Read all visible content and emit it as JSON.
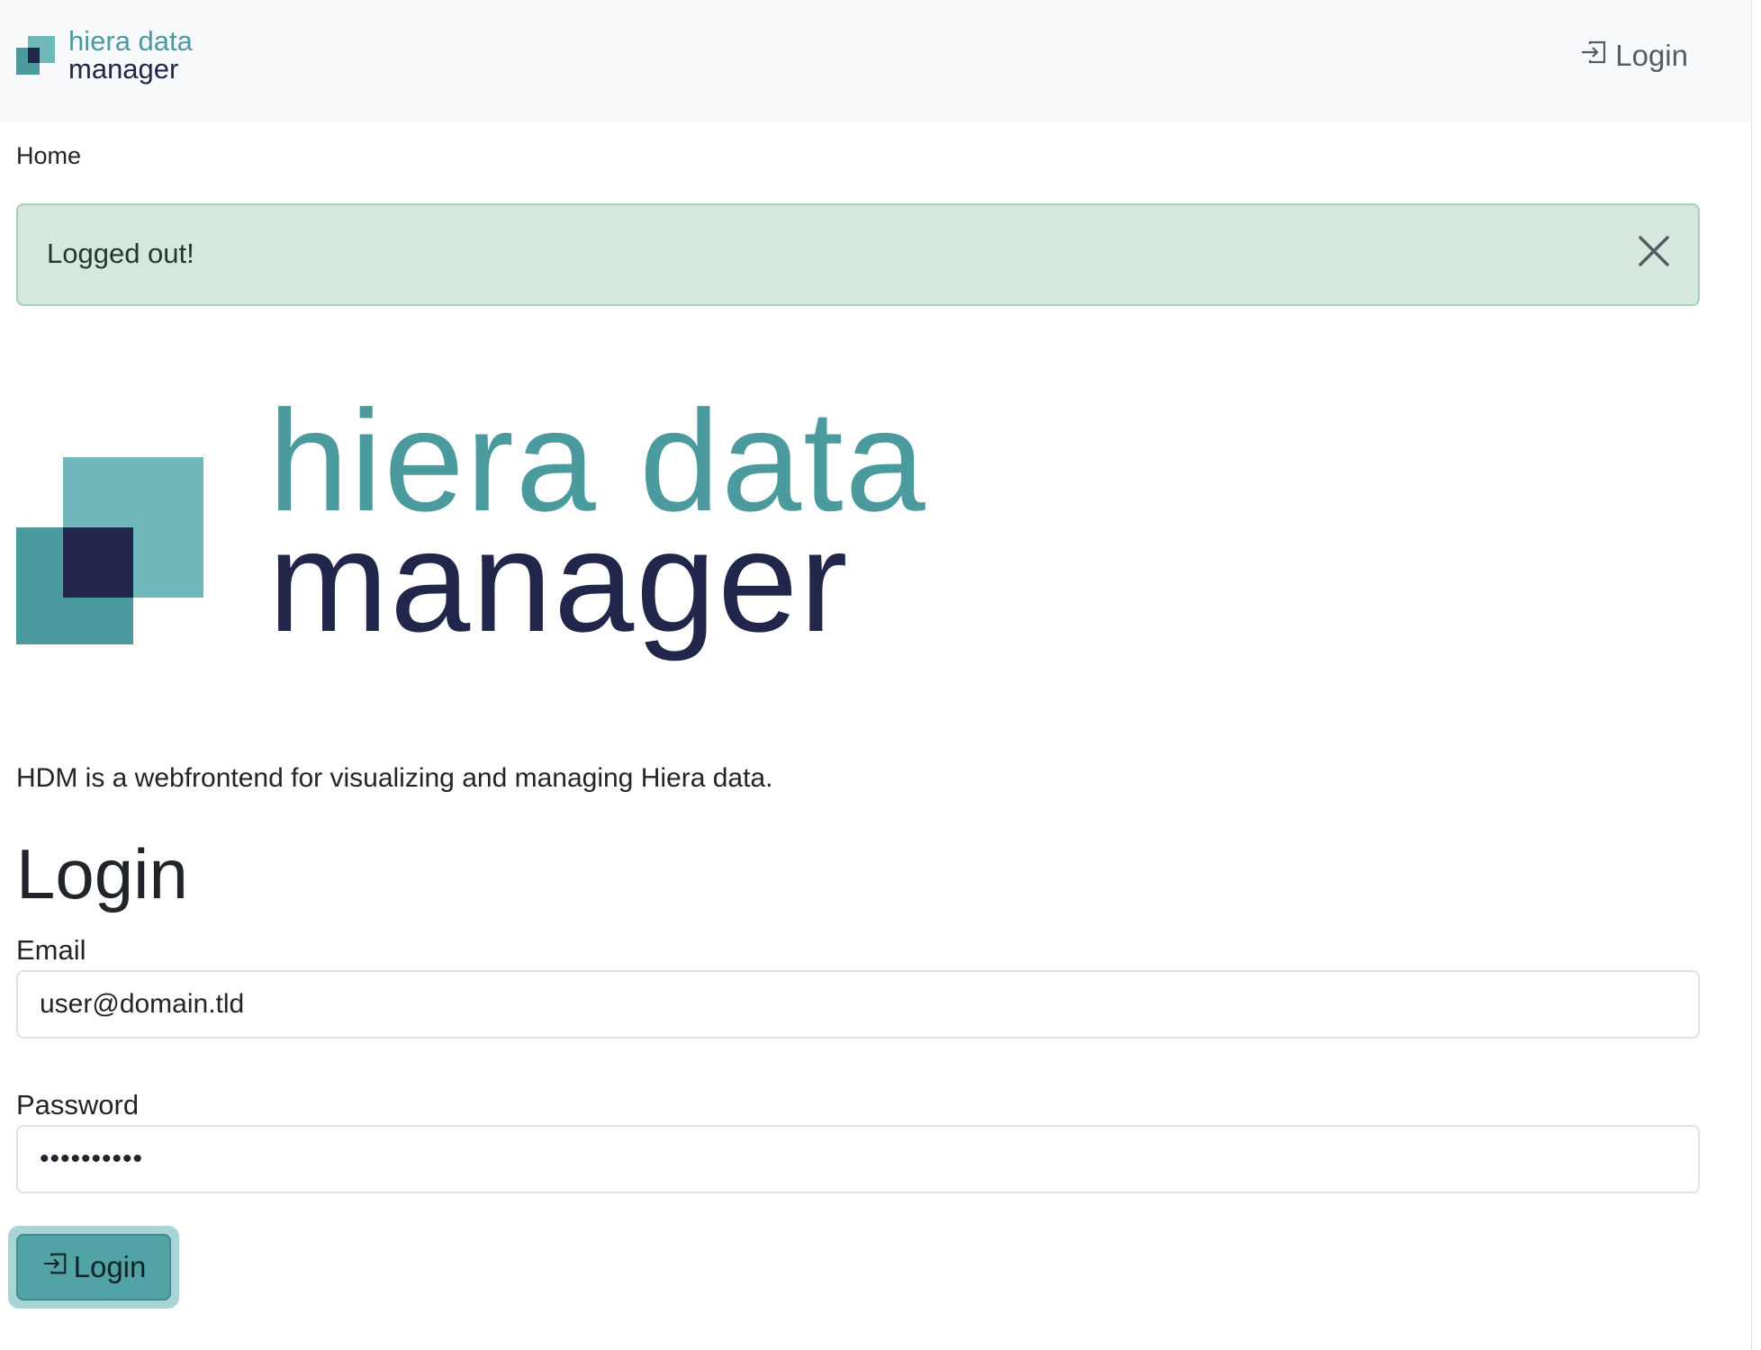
{
  "navbar": {
    "logo_line1": "hiera data",
    "logo_line2": "manager",
    "login_label": "Login",
    "login_icon": "box-arrow-in-right-icon"
  },
  "breadcrumb": {
    "home_label": "Home"
  },
  "alert": {
    "message": "Logged out!",
    "close_icon": "close-icon"
  },
  "hero": {
    "line1": "hiera data",
    "line2": "manager"
  },
  "main": {
    "description": "HDM is a webfrontend for visualizing and managing Hiera data.",
    "login_heading": "Login"
  },
  "form": {
    "email_label": "Email",
    "email_value": "user@domain.tld",
    "password_label": "Password",
    "password_value": "••••••••••",
    "submit_label": "Login",
    "submit_icon": "box-arrow-in-right-icon"
  },
  "colors": {
    "brand_teal": "#4b9a9e",
    "brand_teal_light": "#71b8bc",
    "brand_navy": "#22264a",
    "navbar_bg": "#f8f9fa",
    "alert_bg": "#d6e8dd",
    "alert_border": "#a6d1b6",
    "button_bg": "#52a3a6"
  }
}
